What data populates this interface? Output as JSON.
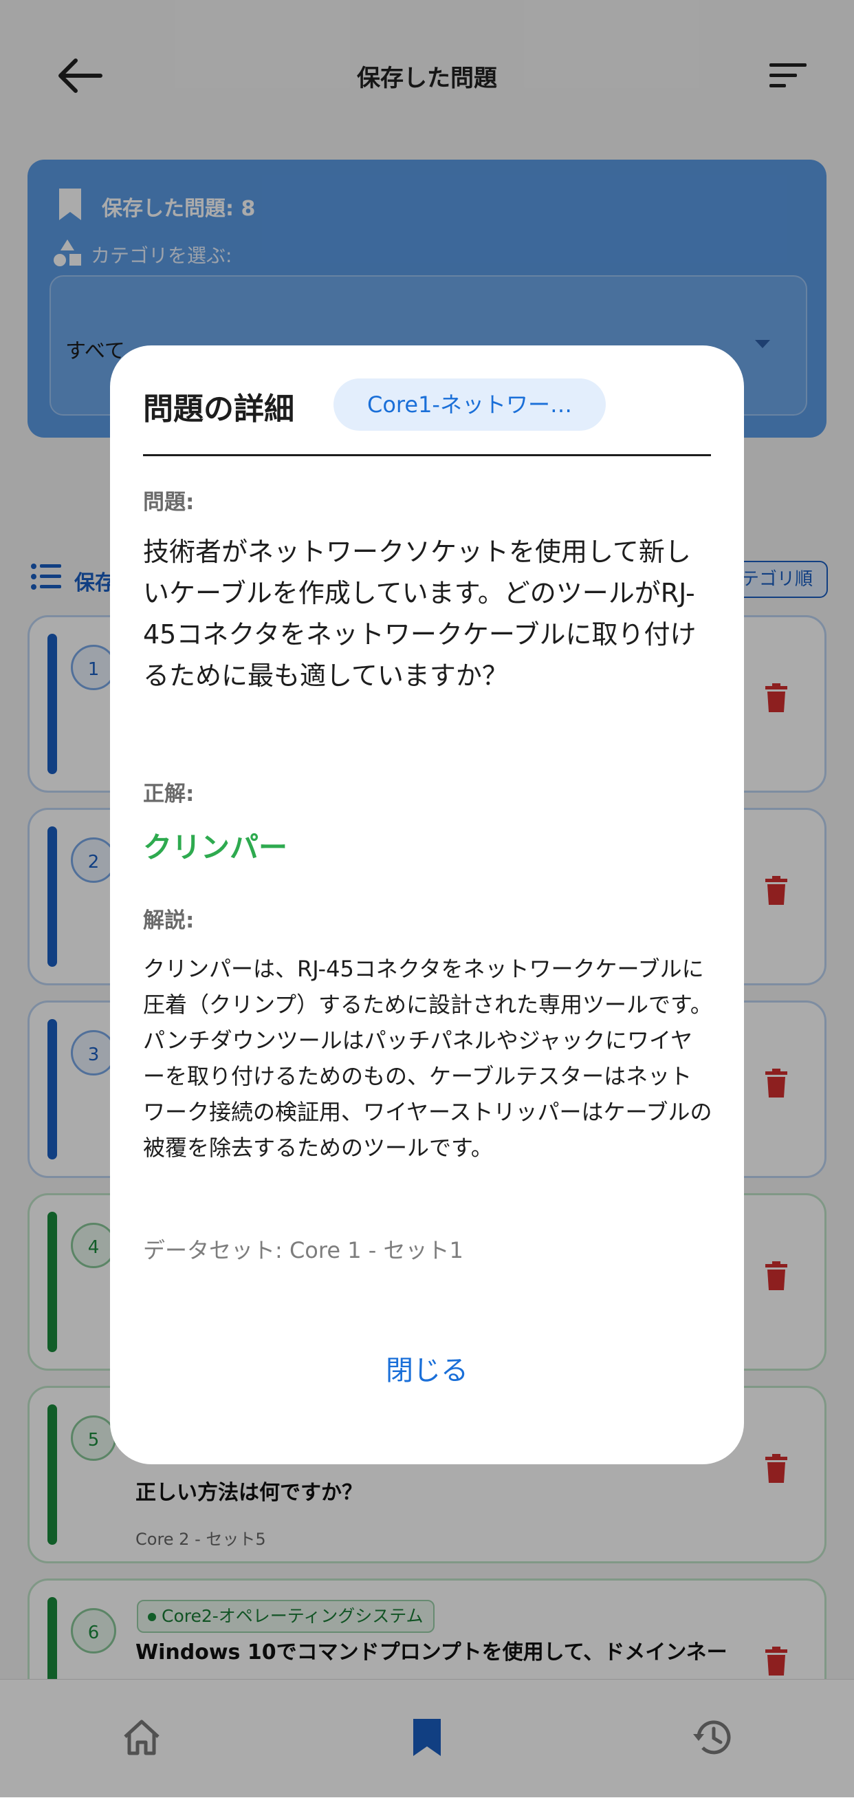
{
  "app_bar": {
    "title": "保存した問題"
  },
  "summary": {
    "saved_count": "保存した問題: 8",
    "category_label": "カテゴリを選ぶ:",
    "category_value": "すべて"
  },
  "list_header": {
    "title": "保存",
    "sort_label": "カテゴリ順"
  },
  "questions": [
    {
      "num": "1",
      "color": "#1a5fc2"
    },
    {
      "num": "2",
      "color": "#1a5fc2"
    },
    {
      "num": "3",
      "color": "#1a5fc2"
    },
    {
      "num": "4",
      "color": "#1a8b3c"
    },
    {
      "num": "5",
      "color": "#1a8b3c",
      "text": "正しい方法は何ですか？",
      "set": "Core 2 - セット5"
    },
    {
      "num": "6",
      "color": "#1a8b3c",
      "tag": "Core2-オペレーティングシステム",
      "text": "Windows 10でコマンドプロンプトを使用して、ドメインネー"
    }
  ],
  "dialog": {
    "title": "問題の詳細",
    "category_chip": "Core1-ネットワー…",
    "question_label": "問題:",
    "question": "技術者がネットワークソケットを使用して新しいケーブルを作成しています。どのツールがRJ-45コネクタをネットワークケーブルに取り付けるために最も適していますか？",
    "answer_label": "正解:",
    "answer": "クリンパー",
    "explanation_label": "解説:",
    "explanation": "クリンパーは、RJ-45コネクタをネットワークケーブルに圧着（クリンプ）するために設計された専用ツールです。パンチダウンツールはパッチパネルやジャックにワイヤーを取り付けるためのもの、ケーブルテスターはネットワーク接続の検証用、ワイヤーストリッパーはケーブルの被覆を除去するためのツールです。",
    "dataset": "データセット: Core 1 - セット1",
    "close_label": "閉じる"
  },
  "colors": {
    "accent": "#1a6fd8",
    "correct": "#2eaa4f",
    "delete": "#d32f2f"
  },
  "icons": {
    "back": "arrow-left-icon",
    "sort": "sort-icon",
    "bookmark": "bookmark-icon",
    "home": "home-icon",
    "history": "history-icon",
    "delete": "trash-icon"
  }
}
